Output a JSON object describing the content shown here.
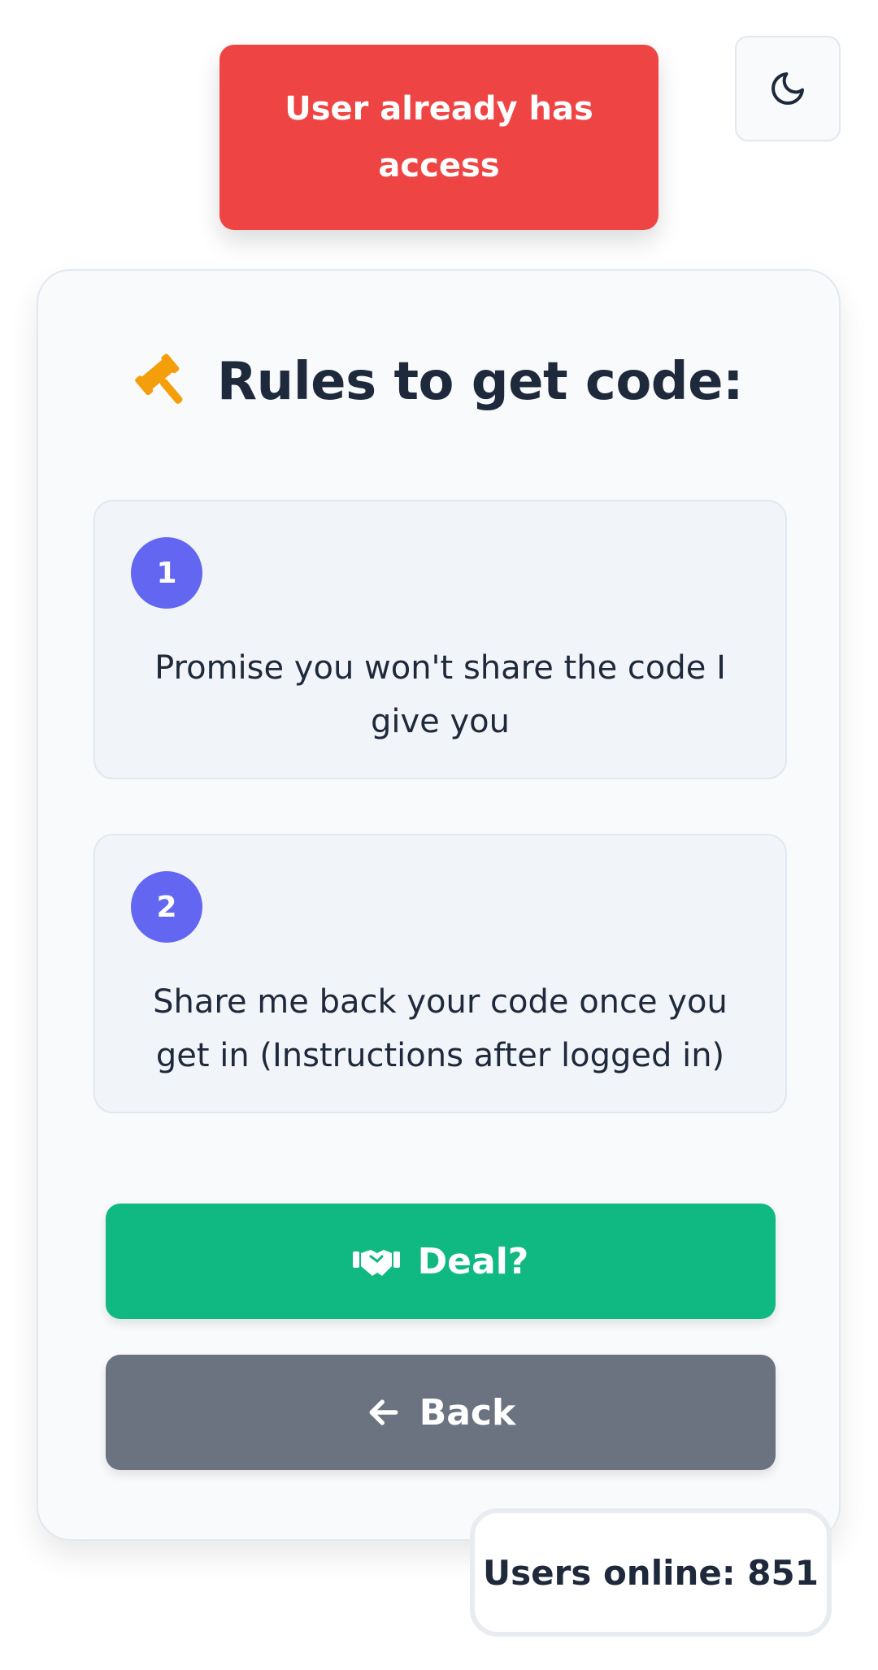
{
  "toast": {
    "message": "User already has access",
    "color": "#ef4444"
  },
  "theme_toggle": {
    "icon": "moon-icon"
  },
  "card": {
    "title": "Rules to get code:",
    "title_icon": "gavel-icon",
    "rules": [
      {
        "number": "1",
        "text": "Promise you won't share the code I give you"
      },
      {
        "number": "2",
        "text": "Share me back your code once you get in (Instructions after logged in)"
      }
    ],
    "accent_color": "#6366f1"
  },
  "buttons": {
    "deal": {
      "label": "Deal?",
      "icon": "handshake-icon",
      "color": "#10b981"
    },
    "back": {
      "label": "Back",
      "icon": "arrow-left-icon",
      "color": "#6b7280"
    }
  },
  "status": {
    "users_online": "Users online: 851"
  }
}
